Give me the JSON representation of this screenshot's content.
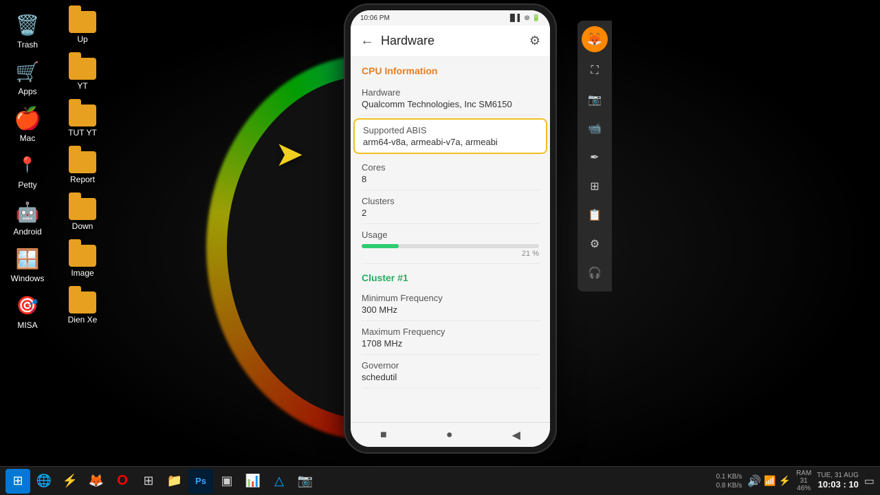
{
  "desktop": {
    "icons": [
      {
        "id": "trash",
        "label": "Trash",
        "icon": "🗑️",
        "type": "system"
      },
      {
        "id": "apps",
        "label": "Apps",
        "icon": "🛒",
        "type": "system"
      },
      {
        "id": "mac",
        "label": "Mac",
        "icon": "🍎",
        "type": "system"
      },
      {
        "id": "android",
        "label": "Android",
        "icon": "🤖",
        "type": "system"
      },
      {
        "id": "windows",
        "label": "Windows",
        "icon": "🪟",
        "type": "system"
      },
      {
        "id": "misa",
        "label": "MISA",
        "icon": "🎯",
        "type": "system"
      }
    ],
    "folders": [
      {
        "id": "up",
        "label": "Up"
      },
      {
        "id": "yt",
        "label": "YT"
      },
      {
        "id": "tut-yt",
        "label": "TUT YT"
      },
      {
        "id": "report",
        "label": "Report"
      },
      {
        "id": "down",
        "label": "Down"
      },
      {
        "id": "image",
        "label": "Image"
      },
      {
        "id": "dien-xe",
        "label": "Dien Xe"
      }
    ]
  },
  "phone": {
    "status_bar": {
      "time": "10:06 PM",
      "signal": "▐▌▌▌",
      "wifi": "WiFi",
      "battery": "██"
    },
    "app_bar": {
      "title": "Hardware",
      "back_label": "←",
      "settings_label": "⚙"
    },
    "cpu_section_title": "CPU Information",
    "hardware_label": "Hardware",
    "hardware_value": "Qualcomm Technologies, Inc SM6150",
    "supported_abis_label": "Supported ABIS",
    "supported_abis_value": "arm64-v8a, armeabi-v7a, armeabi",
    "cores_label": "Cores",
    "cores_value": "8",
    "clusters_label": "Clusters",
    "clusters_value": "2",
    "usage_label": "Usage",
    "usage_percent": "21 %",
    "usage_value": 21,
    "cluster_section_title": "Cluster #1",
    "min_freq_label": "Minimum Frequency",
    "min_freq_value": "300 MHz",
    "max_freq_label": "Maximum Frequency",
    "max_freq_value": "1708 MHz",
    "governor_label": "Governor",
    "governor_value": "schedutil",
    "nav": {
      "square": "■",
      "circle": "●",
      "triangle": "◀"
    }
  },
  "tool_panel": {
    "avatar_icon": "🦊",
    "expand_icon": "⛶",
    "camera_icon": "📷",
    "record_icon": "📹",
    "pen_icon": "✒",
    "grid_icon": "⊞",
    "clip_icon": "📋",
    "gear_icon": "⚙",
    "headphone_icon": "🎧"
  },
  "taskbar": {
    "start_icon": "⊞",
    "browser1_icon": "🌐",
    "browser2_icon": "⚡",
    "firefox_icon": "🦊",
    "opera_icon": "○",
    "windows_icon": "⊞",
    "files_icon": "📁",
    "ps_icon": "Ps",
    "term_icon": "▣",
    "chart_icon": "📊",
    "azure_icon": "△",
    "camera_icon": "📷",
    "network": {
      "up": "0.1 KB/s",
      "down": "0.8 KB/s"
    },
    "ram": {
      "label1": "RAM",
      "label2": "31",
      "label3": "46%"
    },
    "date": "TUE, 31 AUG",
    "time": "10:03 : 10"
  }
}
